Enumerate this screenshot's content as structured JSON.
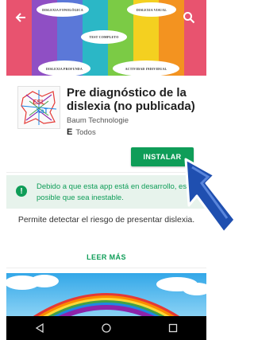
{
  "hero": {
    "labels": {
      "top_left": "DISLEXIA FONOLÓGICA",
      "top_right": "DISLEXIA VISUAL",
      "middle": "TEST COMPLETO",
      "bottom_left": "DISLEXIA PROFUNDA",
      "bottom_right": "ACTIVIDAD INDIVIDUAL"
    },
    "stripe_colors": [
      "#e8536f",
      "#8f4fc4",
      "#5b78d8",
      "#2bb7c6",
      "#7bcb45",
      "#f4d020",
      "#f39320",
      "#e8536f"
    ],
    "icons": {
      "back": "arrow-back-icon",
      "search": "search-icon"
    }
  },
  "app": {
    "icon": {
      "name": "eslixate-logo-icon",
      "text_top": "ESL",
      "text_bottom": "XaT"
    },
    "title": "Pre diagnóstico de la dislexia (no publicada)",
    "developer": "Baum Technologie",
    "rating_symbol": "E",
    "rating": "Todos"
  },
  "actions": {
    "install_label": "INSTALAR",
    "accent": "#0f9d58"
  },
  "warning": {
    "icon": "!",
    "text": "Debido a que esta app está en desarrollo, es posible que sea inestable."
  },
  "description": {
    "text": "Permite detectar el riesgo de presentar dislexia.",
    "read_more": "LEER MÁS"
  },
  "navbar": {
    "icons": [
      "back-triangle-icon",
      "home-circle-icon",
      "recents-square-icon"
    ]
  }
}
